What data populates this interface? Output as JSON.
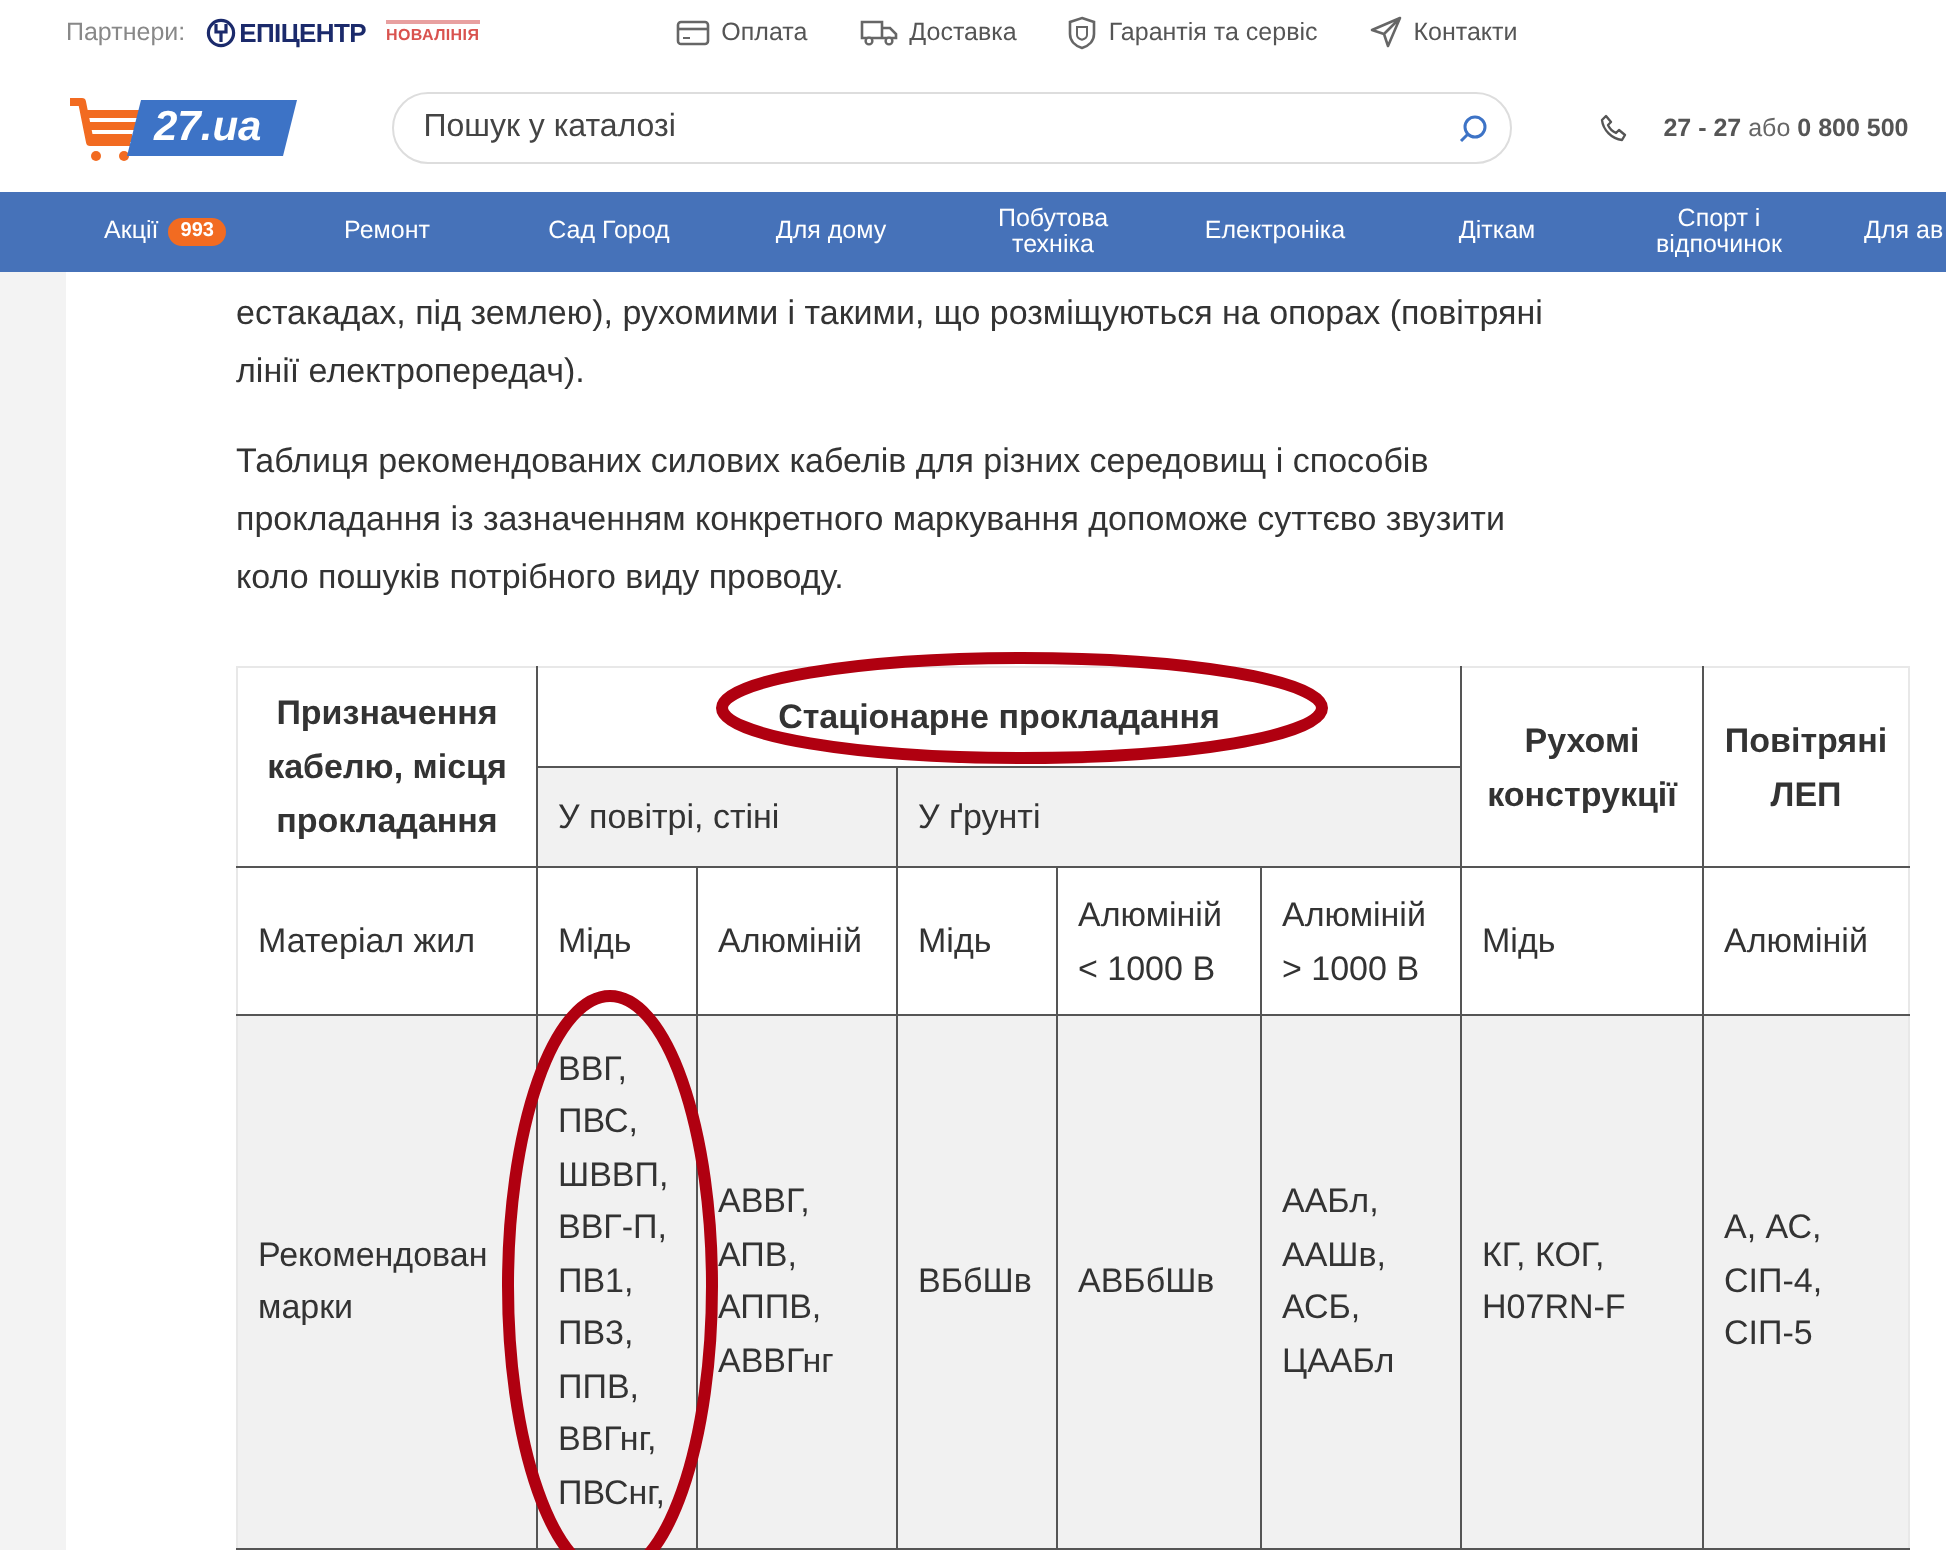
{
  "partners": {
    "label": "Партнери:",
    "logos": [
      {
        "kind": "epicentr",
        "text": "ЕПІЦЕНТР"
      },
      {
        "kind": "novalinia",
        "text": "НОВАЛІНІЯ"
      }
    ]
  },
  "top_links": [
    {
      "kind": "card",
      "label": "Оплата"
    },
    {
      "kind": "truck",
      "label": "Доставка"
    },
    {
      "kind": "shield",
      "label": "Гарантія та сервіс"
    },
    {
      "kind": "send",
      "label": "Контакти"
    }
  ],
  "logo": {
    "text": "27.ua"
  },
  "search": {
    "placeholder": "Пошук у каталозі"
  },
  "phone": {
    "number": "27 - 27",
    "separator": "або",
    "number_2": "0 800 500"
  },
  "nav": [
    {
      "label": "Акції",
      "badge": "993"
    },
    {
      "label": "Ремонт"
    },
    {
      "label": "Сад Город"
    },
    {
      "label": "Для дому"
    },
    {
      "label": "Побутова техніка"
    },
    {
      "label": "Електроніка"
    },
    {
      "label": "Діткам"
    },
    {
      "label": "Спорт і відпочинок"
    },
    {
      "label": "Для ав"
    }
  ],
  "article": {
    "paragraphs": [
      [
        "естакадах, під землею), рухомими і такими, що розміщуються на опорах (повітряні",
        "лінії електропередач)."
      ],
      [
        "Таблиця рекомендованих силових кабелів для різних середовищ і способів",
        "прокладання із зазначенням конкретного маркування допоможе суттєво звузити",
        "коло пошуків потрібного виду проводу."
      ]
    ]
  },
  "table": {
    "purpose_header": "Призначення кабелю, місця прокладання",
    "stationary_header": "Стаціонарне прокладання",
    "air_header": "У повітрі, стіні",
    "ground_header": "У ґрунті",
    "mobile_header": "Рухомі конструкції",
    "overhead_header": "Повітряні ЛЕП",
    "material_row": {
      "label": "Матеріал жил",
      "values": [
        "Мідь",
        "Алюміній",
        "Мідь",
        "Алюміній < 1000 В",
        "Алюміній > 1000 В",
        "Мідь",
        "Алюміній"
      ]
    },
    "brands_row": {
      "label": "Рекомендован марки",
      "values": [
        [
          "ВВГ,",
          "ПВС,",
          "ШВВП,",
          "ВВГ-П,",
          "ПВ1,",
          "ПВ3,",
          "ППВ,",
          "ВВГнг,",
          "ПВСнг,"
        ],
        [
          "АВВГ,",
          "АПВ,",
          "АППВ,",
          "АВВГнг"
        ],
        [
          "ВБбШв"
        ],
        [
          "АВБбШв"
        ],
        [
          "ААБл,",
          "ААШв,",
          "АСБ,",
          "ЦААБл"
        ],
        [
          "КГ, КОГ,",
          "H07RN-F"
        ],
        [
          "А, АС,",
          "СІП-4,",
          "СІП-5"
        ]
      ]
    }
  }
}
